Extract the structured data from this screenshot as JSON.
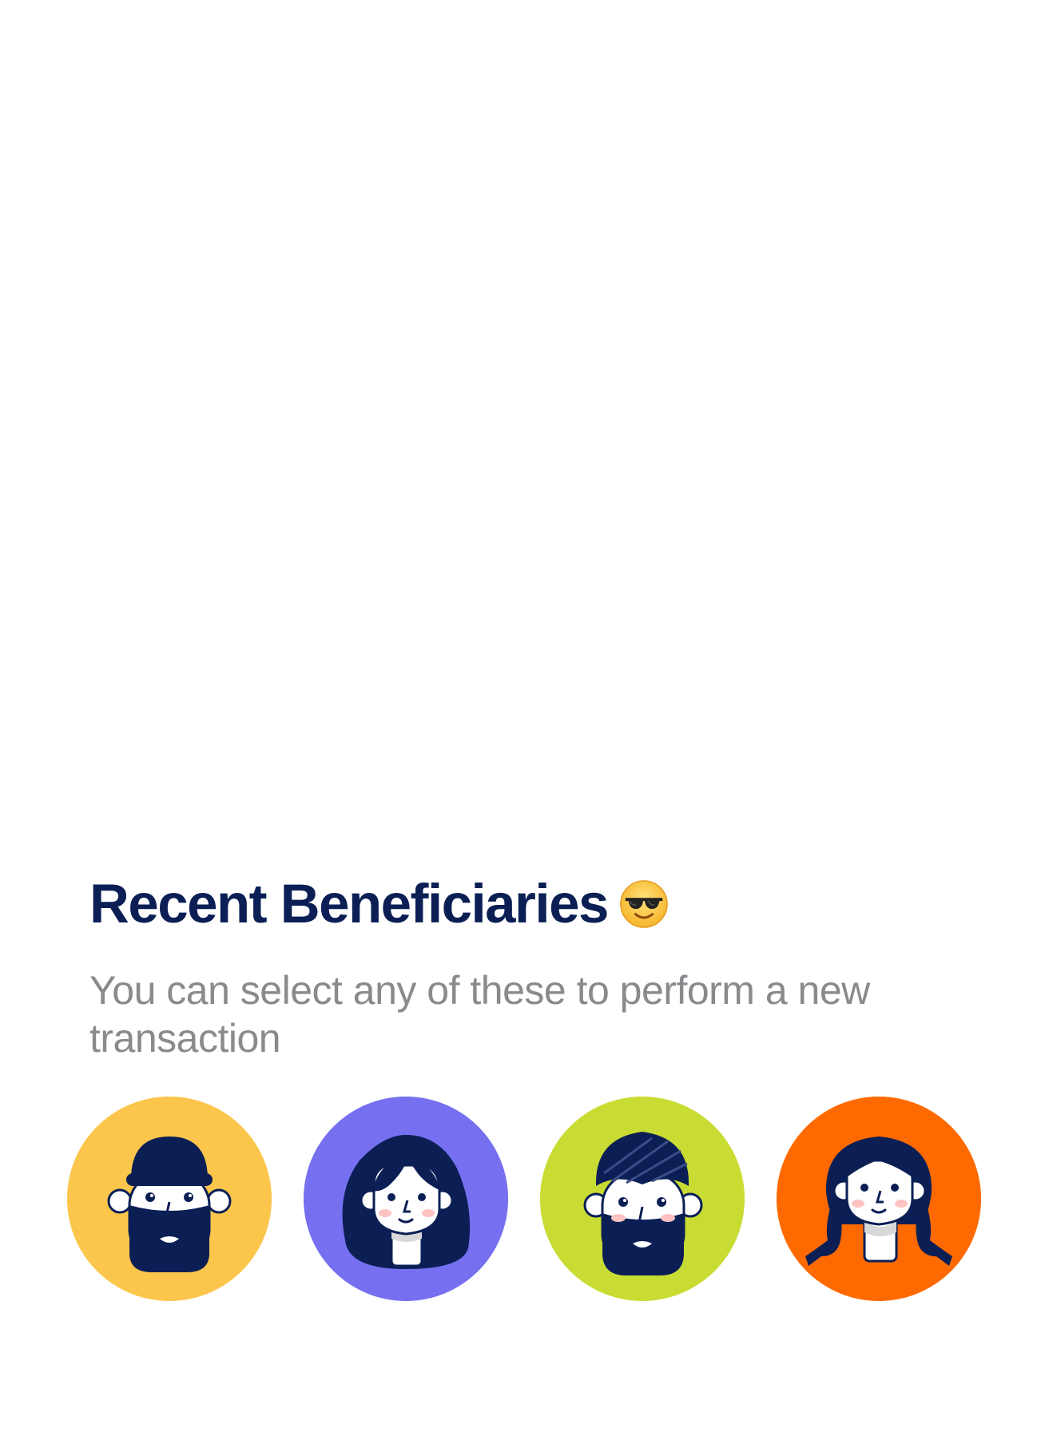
{
  "header": {
    "title": "Recent Beneficiaries",
    "emoji_icon": "smiling-face-with-sunglasses-icon",
    "subtitle": "You can select any of these to perform a new transaction"
  },
  "colors": {
    "title": "#0b1f55",
    "subtitle": "#8a8a8e",
    "avatar_ink": "#0b1f55"
  },
  "beneficiaries": [
    {
      "avatar_icon": "bearded-man-beanie-avatar-icon",
      "background": "#fcc64c"
    },
    {
      "avatar_icon": "woman-long-hair-avatar-icon",
      "background": "#7670f0"
    },
    {
      "avatar_icon": "man-turban-beard-avatar-icon",
      "background": "#c9dc34"
    },
    {
      "avatar_icon": "girl-braids-avatar-icon",
      "background": "#ff6a00"
    }
  ]
}
